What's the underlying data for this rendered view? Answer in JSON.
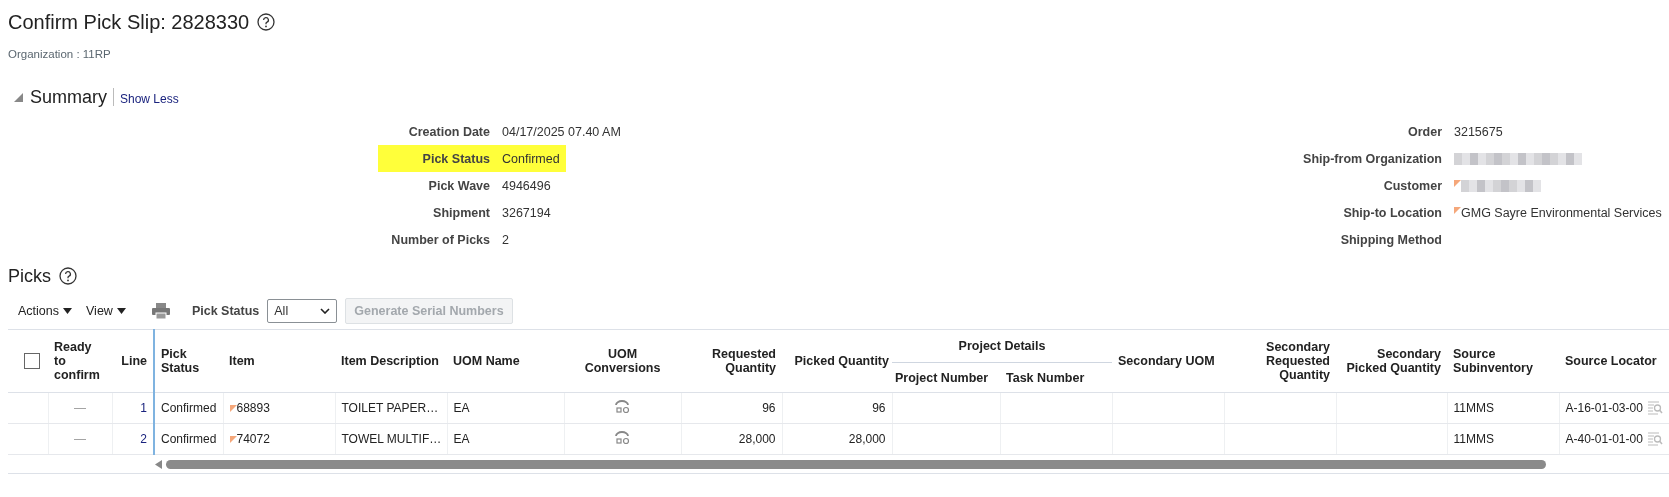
{
  "page": {
    "title": "Confirm Pick Slip: 2828330",
    "organization": "Organization : 11RP"
  },
  "summary": {
    "title": "Summary",
    "toggle": "Show Less",
    "expanded": true,
    "left": [
      {
        "label": "Creation Date",
        "value": "04/17/2025 07.40 AM",
        "highlighted": false
      },
      {
        "label": "Pick Status",
        "value": "Confirmed",
        "highlighted": true
      },
      {
        "label": "Pick Wave",
        "value": "4946496",
        "highlighted": false
      },
      {
        "label": "Shipment",
        "value": "3267194",
        "highlighted": false
      },
      {
        "label": "Number of Picks",
        "value": "2",
        "highlighted": false
      }
    ],
    "right": [
      {
        "label": "Order",
        "value": "3215675",
        "flagged": false,
        "redacted": false
      },
      {
        "label": "Ship-from Organization",
        "flagged": false,
        "redacted": true
      },
      {
        "label": "Customer",
        "flagged": true,
        "redacted": true
      },
      {
        "label": "Ship-to Location",
        "value": "GMG Sayre Environmental Services",
        "flagged": true,
        "redacted": false
      },
      {
        "label": "Shipping Method",
        "flagged": false,
        "redacted": false
      }
    ]
  },
  "picks": {
    "title": "Picks",
    "toolbar": {
      "actions": "Actions",
      "view": "View",
      "filter_label": "Pick Status",
      "filter_value": "All",
      "generate_button": {
        "label": "Generate Serial Numbers",
        "disabled": true
      }
    },
    "select_all": {
      "checked": false
    },
    "columns": {
      "ready": "Ready to confirm",
      "line": "Line",
      "pick_status": "Pick Status",
      "item": "Item",
      "item_description": "Item Description",
      "uom_name": "UOM Name",
      "uom_conversions": "UOM Conversions",
      "requested_quantity": "Requested Quantity",
      "picked_quantity": "Picked Quantity",
      "project_details": "Project Details",
      "project_number": "Project Number",
      "task_number": "Task Number",
      "secondary_uom": "Secondary UOM",
      "secondary_requested_quantity": "Secondary Requested Quantity",
      "secondary_picked_quantity": "Secondary Picked Quantity",
      "source_subinventory": "Source Subinventory",
      "source_locator": "Source Locator"
    },
    "rows": [
      {
        "ready": "—",
        "line": "1",
        "pick_status": "Confirmed",
        "item": "68893",
        "item_flagged": true,
        "item_description": "TOILET PAPER…",
        "uom_name": "EA",
        "requested_quantity": "96",
        "picked_quantity": "96",
        "source_subinventory": "11MMS",
        "source_locator": "A-16-01-03-00"
      },
      {
        "ready": "—",
        "line": "2",
        "pick_status": "Confirmed",
        "item": "74072",
        "item_flagged": true,
        "item_description": "TOWEL MULTIF…",
        "uom_name": "EA",
        "requested_quantity": "28,000",
        "picked_quantity": "28,000",
        "source_subinventory": "11MMS",
        "source_locator": "A-40-01-01-00"
      }
    ]
  }
}
